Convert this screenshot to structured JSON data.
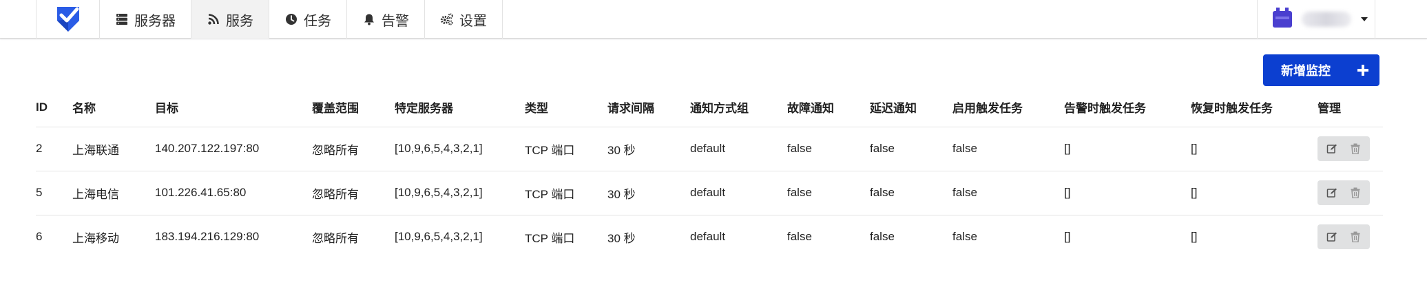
{
  "nav": {
    "logo_icon": "shield-check-logo",
    "items": [
      {
        "label": "服务器",
        "icon": "server-icon"
      },
      {
        "label": "服务",
        "icon": "rss-icon"
      },
      {
        "label": "任务",
        "icon": "clock-icon"
      },
      {
        "label": "告警",
        "icon": "bell-icon"
      },
      {
        "label": "设置",
        "icon": "gears-icon"
      }
    ],
    "active_index": 1,
    "user_icon": "user-avatar"
  },
  "toolbar": {
    "add_label": "新增监控",
    "add_icon": "plus-icon"
  },
  "table": {
    "columns": [
      "ID",
      "名称",
      "目标",
      "覆盖范围",
      "特定服务器",
      "类型",
      "请求间隔",
      "通知方式组",
      "故障通知",
      "延迟通知",
      "启用触发任务",
      "告警时触发任务",
      "恢复时触发任务",
      "管理"
    ],
    "rows": [
      [
        "2",
        "上海联通",
        "140.207.122.197:80",
        "忽略所有",
        "[10,9,6,5,4,3,2,1]",
        "TCP 端口",
        "30 秒",
        "default",
        "false",
        "false",
        "false",
        "[]",
        "[]"
      ],
      [
        "5",
        "上海电信",
        "101.226.41.65:80",
        "忽略所有",
        "[10,9,6,5,4,3,2,1]",
        "TCP 端口",
        "30 秒",
        "default",
        "false",
        "false",
        "false",
        "[]",
        "[]"
      ],
      [
        "6",
        "上海移动",
        "183.194.216.129:80",
        "忽略所有",
        "[10,9,6,5,4,3,2,1]",
        "TCP 端口",
        "30 秒",
        "default",
        "false",
        "false",
        "false",
        "[]",
        "[]"
      ]
    ],
    "row_actions": [
      "edit-icon",
      "delete-icon"
    ]
  },
  "colors": {
    "accent": "#0c3fd0",
    "logo_blue": "#2a5ce6",
    "action_bg": "#e0e1e2",
    "border": "#e3e3e3"
  }
}
